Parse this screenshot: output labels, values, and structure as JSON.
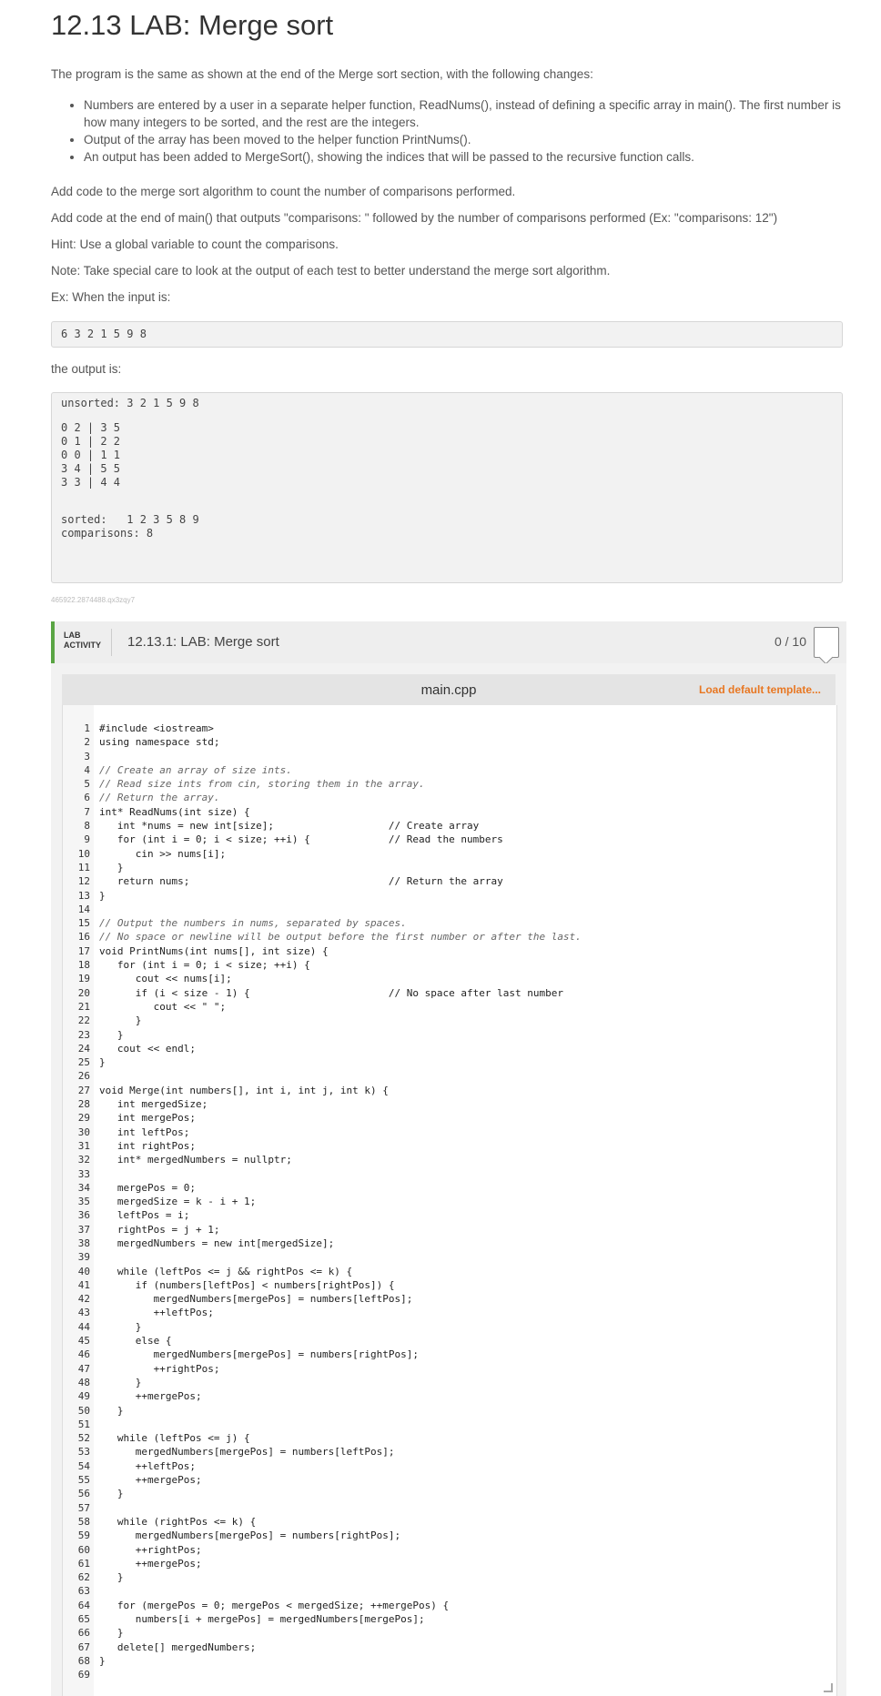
{
  "title": "12.13 LAB: Merge sort",
  "intro": "The program is the same as shown at the end of the Merge sort section, with the following changes:",
  "bullets": [
    "Numbers are entered by a user in a separate helper function, ReadNums(), instead of defining a specific array in main(). The first number is how many integers to be sorted, and the rest are the integers.",
    "Output of the array has been moved to the helper function PrintNums().",
    "An output has been added to MergeSort(), showing the indices that will be passed to the recursive function calls."
  ],
  "para_add_code": "Add code to the merge sort algorithm to count the number of comparisons performed.",
  "para_add_main": "Add code at the end of main() that outputs \"comparisons: \" followed by the number of comparisons performed (Ex: \"comparisons: 12\")",
  "para_hint": "Hint: Use a global variable to count the comparisons.",
  "para_note": "Note: Take special care to look at the output of each test to better understand the merge sort algorithm.",
  "para_ex": "Ex: When the input is:",
  "example_input": "6 3 2 1 5 9 8",
  "para_output": "the output is:",
  "example_output": [
    "unsorted: 3 2 1 5 9 8",
    "",
    "0 2 | 3 5",
    "0 1 | 2 2",
    "0 0 | 1 1",
    "3 4 | 5 5",
    "3 3 | 4 4",
    "",
    "sorted:   1 2 3 5 8 9",
    "comparisons: 8"
  ],
  "content_id": "465922.2874488.qx3zqy7",
  "lab": {
    "tag_line1": "LAB",
    "tag_line2": "ACTIVITY",
    "title": "12.13.1: LAB: Merge sort",
    "score": "0 / 10"
  },
  "editor": {
    "file_name": "main.cpp",
    "load_default": "Load default template...",
    "lines": [
      {
        "n": "1",
        "t": "#include <iostream>"
      },
      {
        "n": "2",
        "t": "using namespace std;"
      },
      {
        "n": "3",
        "t": ""
      },
      {
        "n": "4",
        "t": "// Create an array of size ints."
      },
      {
        "n": "5",
        "t": "// Read size ints from cin, storing them in the array."
      },
      {
        "n": "6",
        "t": "// Return the array."
      },
      {
        "n": "7",
        "t": "int* ReadNums(int size) {"
      },
      {
        "n": "8",
        "t": "   int *nums = new int[size];                   // Create array"
      },
      {
        "n": "9",
        "t": "   for (int i = 0; i < size; ++i) {             // Read the numbers"
      },
      {
        "n": "10",
        "t": "      cin >> nums[i];"
      },
      {
        "n": "11",
        "t": "   }"
      },
      {
        "n": "12",
        "t": "   return nums;                                 // Return the array"
      },
      {
        "n": "13",
        "t": "}"
      },
      {
        "n": "14",
        "t": ""
      },
      {
        "n": "15",
        "t": "// Output the numbers in nums, separated by spaces."
      },
      {
        "n": "16",
        "t": "// No space or newline will be output before the first number or after the last."
      },
      {
        "n": "17",
        "t": "void PrintNums(int nums[], int size) {"
      },
      {
        "n": "18",
        "t": "   for (int i = 0; i < size; ++i) {"
      },
      {
        "n": "19",
        "t": "      cout << nums[i];"
      },
      {
        "n": "20",
        "t": "      if (i < size - 1) {                       // No space after last number"
      },
      {
        "n": "21",
        "t": "         cout << \" \";"
      },
      {
        "n": "22",
        "t": "      }"
      },
      {
        "n": "23",
        "t": "   }"
      },
      {
        "n": "24",
        "t": "   cout << endl;"
      },
      {
        "n": "25",
        "t": "}"
      },
      {
        "n": "26",
        "t": ""
      },
      {
        "n": "27",
        "t": "void Merge(int numbers[], int i, int j, int k) {"
      },
      {
        "n": "28",
        "t": "   int mergedSize;"
      },
      {
        "n": "29",
        "t": "   int mergePos;"
      },
      {
        "n": "30",
        "t": "   int leftPos;"
      },
      {
        "n": "31",
        "t": "   int rightPos;"
      },
      {
        "n": "32",
        "t": "   int* mergedNumbers = nullptr;"
      },
      {
        "n": "33",
        "t": ""
      },
      {
        "n": "34",
        "t": "   mergePos = 0;"
      },
      {
        "n": "35",
        "t": "   mergedSize = k - i + 1;"
      },
      {
        "n": "36",
        "t": "   leftPos = i;"
      },
      {
        "n": "37",
        "t": "   rightPos = j + 1;"
      },
      {
        "n": "38",
        "t": "   mergedNumbers = new int[mergedSize];"
      },
      {
        "n": "39",
        "t": ""
      },
      {
        "n": "40",
        "t": "   while (leftPos <= j && rightPos <= k) {"
      },
      {
        "n": "41",
        "t": "      if (numbers[leftPos] < numbers[rightPos]) {"
      },
      {
        "n": "42",
        "t": "         mergedNumbers[mergePos] = numbers[leftPos];"
      },
      {
        "n": "43",
        "t": "         ++leftPos;"
      },
      {
        "n": "44",
        "t": "      }"
      },
      {
        "n": "45",
        "t": "      else {"
      },
      {
        "n": "46",
        "t": "         mergedNumbers[mergePos] = numbers[rightPos];"
      },
      {
        "n": "47",
        "t": "         ++rightPos;"
      },
      {
        "n": "48",
        "t": "      }"
      },
      {
        "n": "49",
        "t": "      ++mergePos;"
      },
      {
        "n": "50",
        "t": "   }"
      },
      {
        "n": "51",
        "t": ""
      },
      {
        "n": "52",
        "t": "   while (leftPos <= j) {"
      },
      {
        "n": "53",
        "t": "      mergedNumbers[mergePos] = numbers[leftPos];"
      },
      {
        "n": "54",
        "t": "      ++leftPos;"
      },
      {
        "n": "55",
        "t": "      ++mergePos;"
      },
      {
        "n": "56",
        "t": "   }"
      },
      {
        "n": "57",
        "t": ""
      },
      {
        "n": "58",
        "t": "   while (rightPos <= k) {"
      },
      {
        "n": "59",
        "t": "      mergedNumbers[mergePos] = numbers[rightPos];"
      },
      {
        "n": "60",
        "t": "      ++rightPos;"
      },
      {
        "n": "61",
        "t": "      ++mergePos;"
      },
      {
        "n": "62",
        "t": "   }"
      },
      {
        "n": "63",
        "t": ""
      },
      {
        "n": "64",
        "t": "   for (mergePos = 0; mergePos < mergedSize; ++mergePos) {"
      },
      {
        "n": "65",
        "t": "      numbers[i + mergePos] = mergedNumbers[mergePos];"
      },
      {
        "n": "66",
        "t": "   }"
      },
      {
        "n": "67",
        "t": "   delete[] mergedNumbers;"
      },
      {
        "n": "68",
        "t": "}"
      },
      {
        "n": "69",
        "t": ""
      }
    ]
  }
}
